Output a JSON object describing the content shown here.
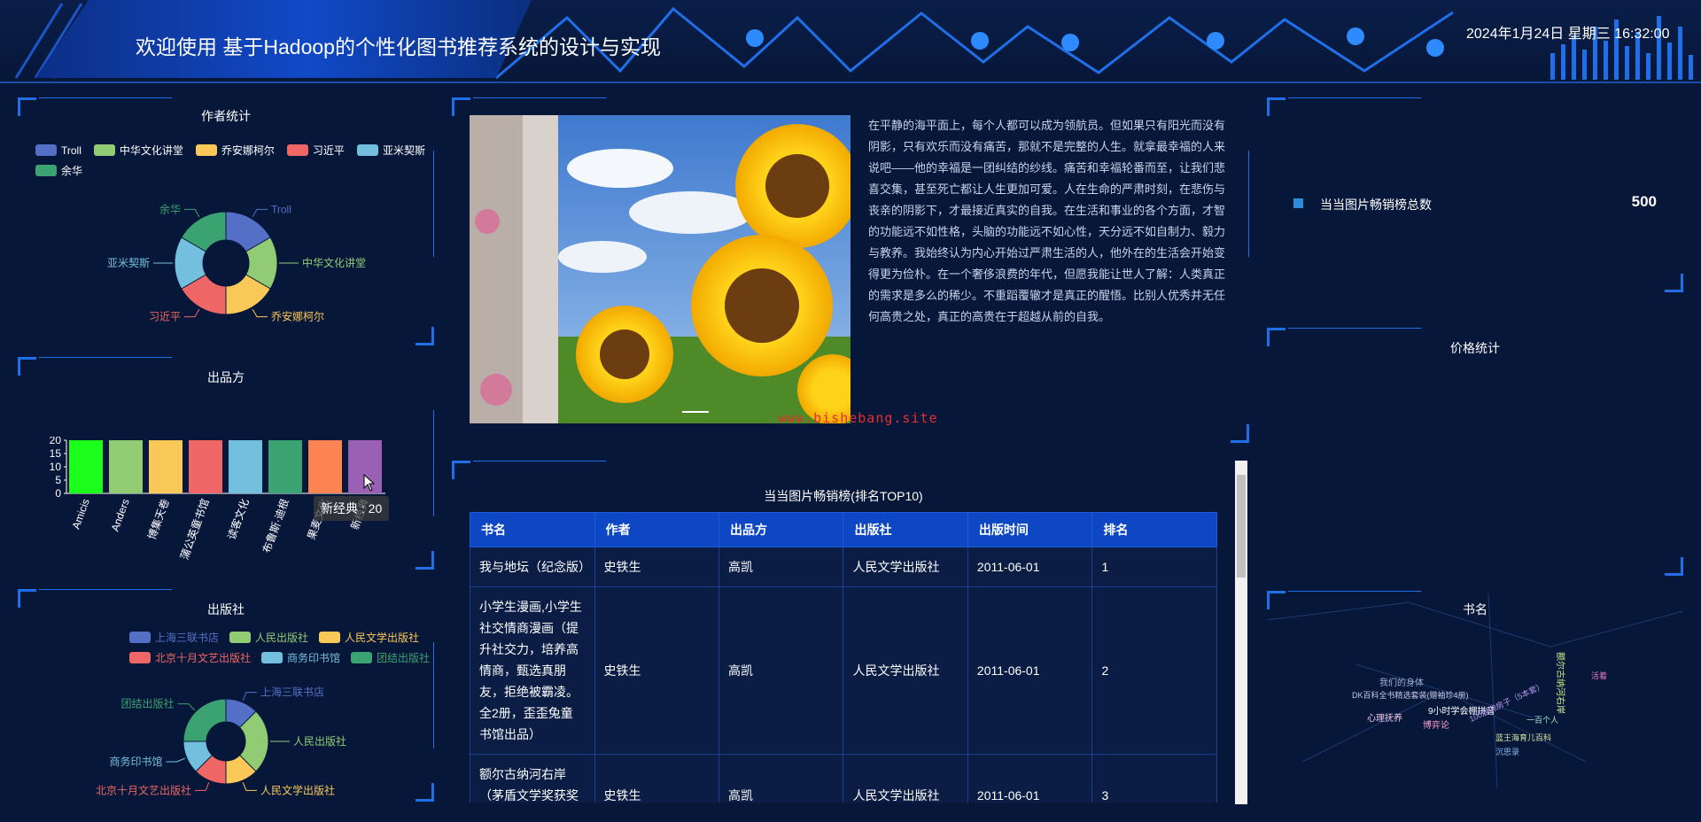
{
  "header": {
    "title": "欢迎使用 基于Hadoop的个性化图书推荐系统的设计与实现",
    "datetime": "2024年1月24日 星期三 16:32:00"
  },
  "author_panel": {
    "title": "作者统计",
    "legend": [
      {
        "name": "Troll",
        "color": "#5470c6"
      },
      {
        "name": "中华文化讲堂",
        "color": "#91cc75"
      },
      {
        "name": "乔安娜柯尔",
        "color": "#fac858"
      },
      {
        "name": "习近平",
        "color": "#ee6666"
      },
      {
        "name": "亚米契斯",
        "color": "#73c0de"
      },
      {
        "name": "余华",
        "color": "#3ba272"
      }
    ]
  },
  "producer_panel": {
    "title": "出品方",
    "tooltip": "新经典 : 20"
  },
  "publisher_panel": {
    "title": "出版社",
    "legend": [
      {
        "name": "上海三联书店",
        "color": "#5470c6"
      },
      {
        "name": "人民出版社",
        "color": "#91cc75"
      },
      {
        "name": "人民文学出版社",
        "color": "#fac858"
      },
      {
        "name": "北京十月文艺出版社",
        "color": "#ee6666"
      },
      {
        "name": "商务印书馆",
        "color": "#73c0de"
      },
      {
        "name": "团结出版社",
        "color": "#3ba272"
      }
    ]
  },
  "intro": {
    "text": "在平静的海平面上，每个人都可以成为领航员。但如果只有阳光而没有阴影，只有欢乐而没有痛苦，那就不是完整的人生。就拿最幸福的人来说吧——他的幸福是一团纠结的纱线。痛苦和幸福轮番而至，让我们悲喜交集，甚至死亡都让人生更加可爱。人在生命的严肃时刻，在悲伤与丧亲的阴影下，才最接近真实的自我。在生活和事业的各个方面，才智的功能远不如性格，头脑的功能远不如心性，天分远不如自制力、毅力与教养。我始终认为内心开始过严肃生活的人，他外在的生活会开始变得更为俭朴。在一个奢侈浪费的年代，但愿我能让世人了解：人类真正的需求是多么的稀少。不重蹈覆辙才是真正的醒悟。比别人优秀并无任何高贵之处，真正的高贵在于超越从前的自我。",
    "watermark": "www.bishebang.site"
  },
  "ranking": {
    "title": "当当图片畅销榜(排名TOP10)",
    "columns": [
      "书名",
      "作者",
      "出品方",
      "出版社",
      "出版时间",
      "排名"
    ],
    "rows": [
      [
        "我与地坛（纪念版）",
        "史铁生",
        "高凯",
        "人民文学出版社",
        "2011-06-01",
        "1"
      ],
      [
        "小学生漫画,小学生社交情商漫画（提升社交力，培养高情商，甄选真朋友，拒绝被霸凌。全2册，歪歪兔童书馆出品）",
        "史铁生",
        "高凯",
        "人民文学出版社",
        "2011-06-01",
        "2"
      ],
      [
        "额尔古纳河右岸（茅盾文学奖获奖作品）",
        "史铁生",
        "高凯",
        "人民文学出版社",
        "2011-06-01",
        "3"
      ]
    ]
  },
  "total_panel": {
    "label": "当当图片畅销榜总数",
    "value": "500"
  },
  "price_panel": {
    "title": "价格统计"
  },
  "bookname_panel": {
    "title": "书名",
    "words": [
      {
        "text": "我们的身体",
        "color": "#9fb0d8"
      },
      {
        "text": "DK百科全书精选套装(赠袖珍4册)",
        "color": "#c6c6e8"
      },
      {
        "text": "9小时学会棚拼音",
        "color": "#ffffff"
      },
      {
        "text": "心理抚养",
        "color": "#f2c9e8"
      },
      {
        "text": "博弈论",
        "color": "#ff9ed0"
      },
      {
        "text": "100层的房子（5本套）",
        "color": "#b59af0"
      },
      {
        "text": "一百个人",
        "color": "#9fe0c0"
      },
      {
        "text": "蓝王海育儿百科",
        "color": "#d8e8a0"
      },
      {
        "text": "沉思录",
        "color": "#8ab8f0"
      },
      {
        "text": "额尔古纳河右岸",
        "color": "#c8f08a"
      },
      {
        "text": "活着",
        "color": "#e87ac8"
      }
    ]
  },
  "chart_data": [
    {
      "type": "pie",
      "title": "作者统计",
      "categories": [
        "Troll",
        "中华文化讲堂",
        "乔安娜柯尔",
        "习近平",
        "亚米契斯",
        "余华"
      ],
      "values": [
        1,
        1,
        1,
        1,
        1,
        1
      ],
      "donut": true,
      "legend": "top"
    },
    {
      "type": "bar",
      "title": "出品方",
      "categories": [
        "Amicis",
        "Anders",
        "博集天卷",
        "蒲公英童书馆",
        "读客文化",
        "布鲁斯·迪根",
        "果麦文化",
        "新经典"
      ],
      "values": [
        20,
        20,
        20,
        20,
        20,
        20,
        20,
        20
      ],
      "ylim": [
        0,
        20
      ],
      "yticks": [
        0,
        5,
        10,
        15,
        20
      ],
      "bar_colors": [
        "#1cff1c",
        "#91cc75",
        "#fac858",
        "#ee6666",
        "#73c0de",
        "#3ba272",
        "#fc8452",
        "#9a60b4"
      ],
      "grid": false
    },
    {
      "type": "pie",
      "title": "出版社",
      "categories": [
        "上海三联书店",
        "人民出版社",
        "人民文学出版社",
        "北京十月文艺出版社",
        "商务印书馆",
        "团结出版社"
      ],
      "values": [
        1,
        2,
        1,
        1,
        1,
        2
      ],
      "donut": true,
      "legend": "top"
    }
  ]
}
